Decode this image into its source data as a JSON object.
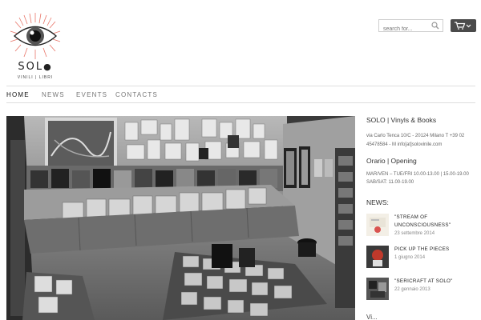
{
  "header": {
    "brand": "SOL",
    "tagline": "VINILI | LIBRI",
    "search_placeholder": "search for...",
    "icons": {
      "logo": "eye-logo-icon",
      "search": "search-icon",
      "cart": "cart-icon",
      "dropdown": "chevron-down-icon"
    }
  },
  "nav": {
    "items": [
      {
        "label": "HOME"
      },
      {
        "label": "NEWS"
      },
      {
        "label": "EVENTS"
      },
      {
        "label": "CONTACTS"
      }
    ]
  },
  "sidebar": {
    "title": "SOLO | Vinyls & Books",
    "address_line1": "via Carlo Tenca 10/C - 20124 Milano T +39 02",
    "address_line2": "45478584 - M info[at]solovinile.com",
    "hours_title": "Orario | Opening",
    "hours_line1": "MAR/VEN – TUE/FRI 10.00-13.00 | 15.00-19.00",
    "hours_line2": "SAB/SAT: 11.00-19.00",
    "news_title": "NEWS:",
    "news": [
      {
        "title": "\"STREAM OF UNCONSCIOUSNESS\"",
        "date": "23 settembre 2014"
      },
      {
        "title": "PICK UP THE PIECES",
        "date": "1 giugno 2014"
      },
      {
        "title": "\"SERICRAFT AT SOLO\"",
        "date": "22 gennaio 2013"
      }
    ],
    "more_label": "Vi..."
  },
  "colors": {
    "nav_border": "#dedede",
    "cart_bg": "#4a4a4a",
    "logo_accent": "#e8766a"
  }
}
